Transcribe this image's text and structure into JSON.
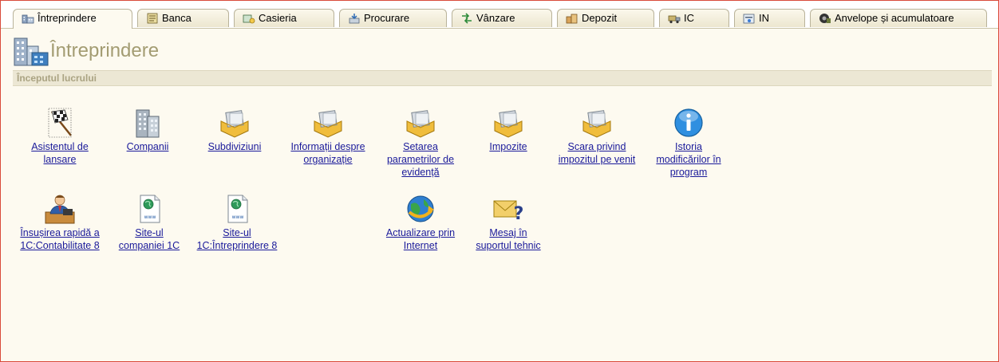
{
  "tabs": [
    {
      "label": "Întreprindere",
      "icon": "enterprise-icon",
      "active": true
    },
    {
      "label": "Banca",
      "icon": "bank-icon"
    },
    {
      "label": "Casieria",
      "icon": "cash-register-icon"
    },
    {
      "label": "Procurare",
      "icon": "purchase-icon"
    },
    {
      "label": "Vânzare",
      "icon": "sales-icon"
    },
    {
      "label": "Depozit",
      "icon": "warehouse-icon"
    },
    {
      "label": "IC",
      "icon": "truck-icon"
    },
    {
      "label": "IN",
      "icon": "intangible-icon"
    },
    {
      "label": "Anvelope și acumulatoare",
      "icon": "tires-icon"
    }
  ],
  "page": {
    "title": "Întreprindere"
  },
  "section": {
    "title": "Începutul lucrului"
  },
  "commands": {
    "row1": [
      {
        "label": "Asistentul de\nlansare",
        "icon": "wizard-flag-icon"
      },
      {
        "label": "Companii",
        "icon": "buildings-icon"
      },
      {
        "label": "Subdiviziuni",
        "icon": "catalog-folder-icon"
      },
      {
        "label": "Informații despre\norganizație",
        "icon": "catalog-folder-icon"
      },
      {
        "label": "Setarea\nparametrilor de\nevidență",
        "icon": "catalog-folder-icon"
      },
      {
        "label": "Impozite",
        "icon": "catalog-folder-icon"
      },
      {
        "label": "Scara privind\nimpozitul pe venit",
        "icon": "catalog-folder-icon"
      },
      {
        "label": "Istoria\nmodificărilor în\nprogram",
        "icon": "info-icon"
      }
    ],
    "row2": [
      {
        "label": "Însușirea rapidă a\n1C:Contabilitate 8",
        "icon": "teacher-icon"
      },
      {
        "label": "Site-ul\ncompaniei 1C",
        "icon": "web-page-icon"
      },
      {
        "label": "Site-ul\n1C:Întreprindere 8",
        "icon": "web-page-icon"
      },
      {
        "label": "Actualizare prin\nInternet",
        "icon": "globe-update-icon"
      },
      {
        "label": "Mesaj în\nsuportul tehnic",
        "icon": "mail-question-icon"
      }
    ]
  }
}
